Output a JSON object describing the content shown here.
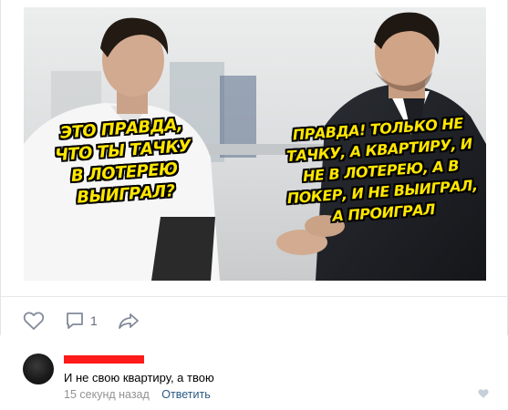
{
  "post": {
    "meme": {
      "caption_left": "ЭТО ПРАВДА,\nЧТО ТЫ ТАЧКУ\nВ ЛОТЕРЕЮ\nВЫИГРАЛ?",
      "caption_right": "ПРАВДА! ТОЛЬКО НЕ\nТАЧКУ, А КВАРТИРУ, И\nНЕ В ЛОТЕРЕЮ, А В\nПОКЕР, И НЕ ВЫИГРАЛ,\nА ПРОИГРАЛ",
      "caption_color": "#ffe600"
    },
    "actions": {
      "like_icon": "heart-outline-icon",
      "comment_icon": "comment-bubble-icon",
      "comment_count": "1",
      "share_icon": "share-arrow-icon"
    }
  },
  "comment": {
    "author_redacted_color": "#ff1a1a",
    "text": "И не свою квартиру, а твою",
    "time": "15 секунд назад",
    "reply_label": "Ответить",
    "like_icon": "heart-icon"
  },
  "colors": {
    "link": "#2a5885",
    "icon": "#828a99",
    "muted": "#939393"
  }
}
